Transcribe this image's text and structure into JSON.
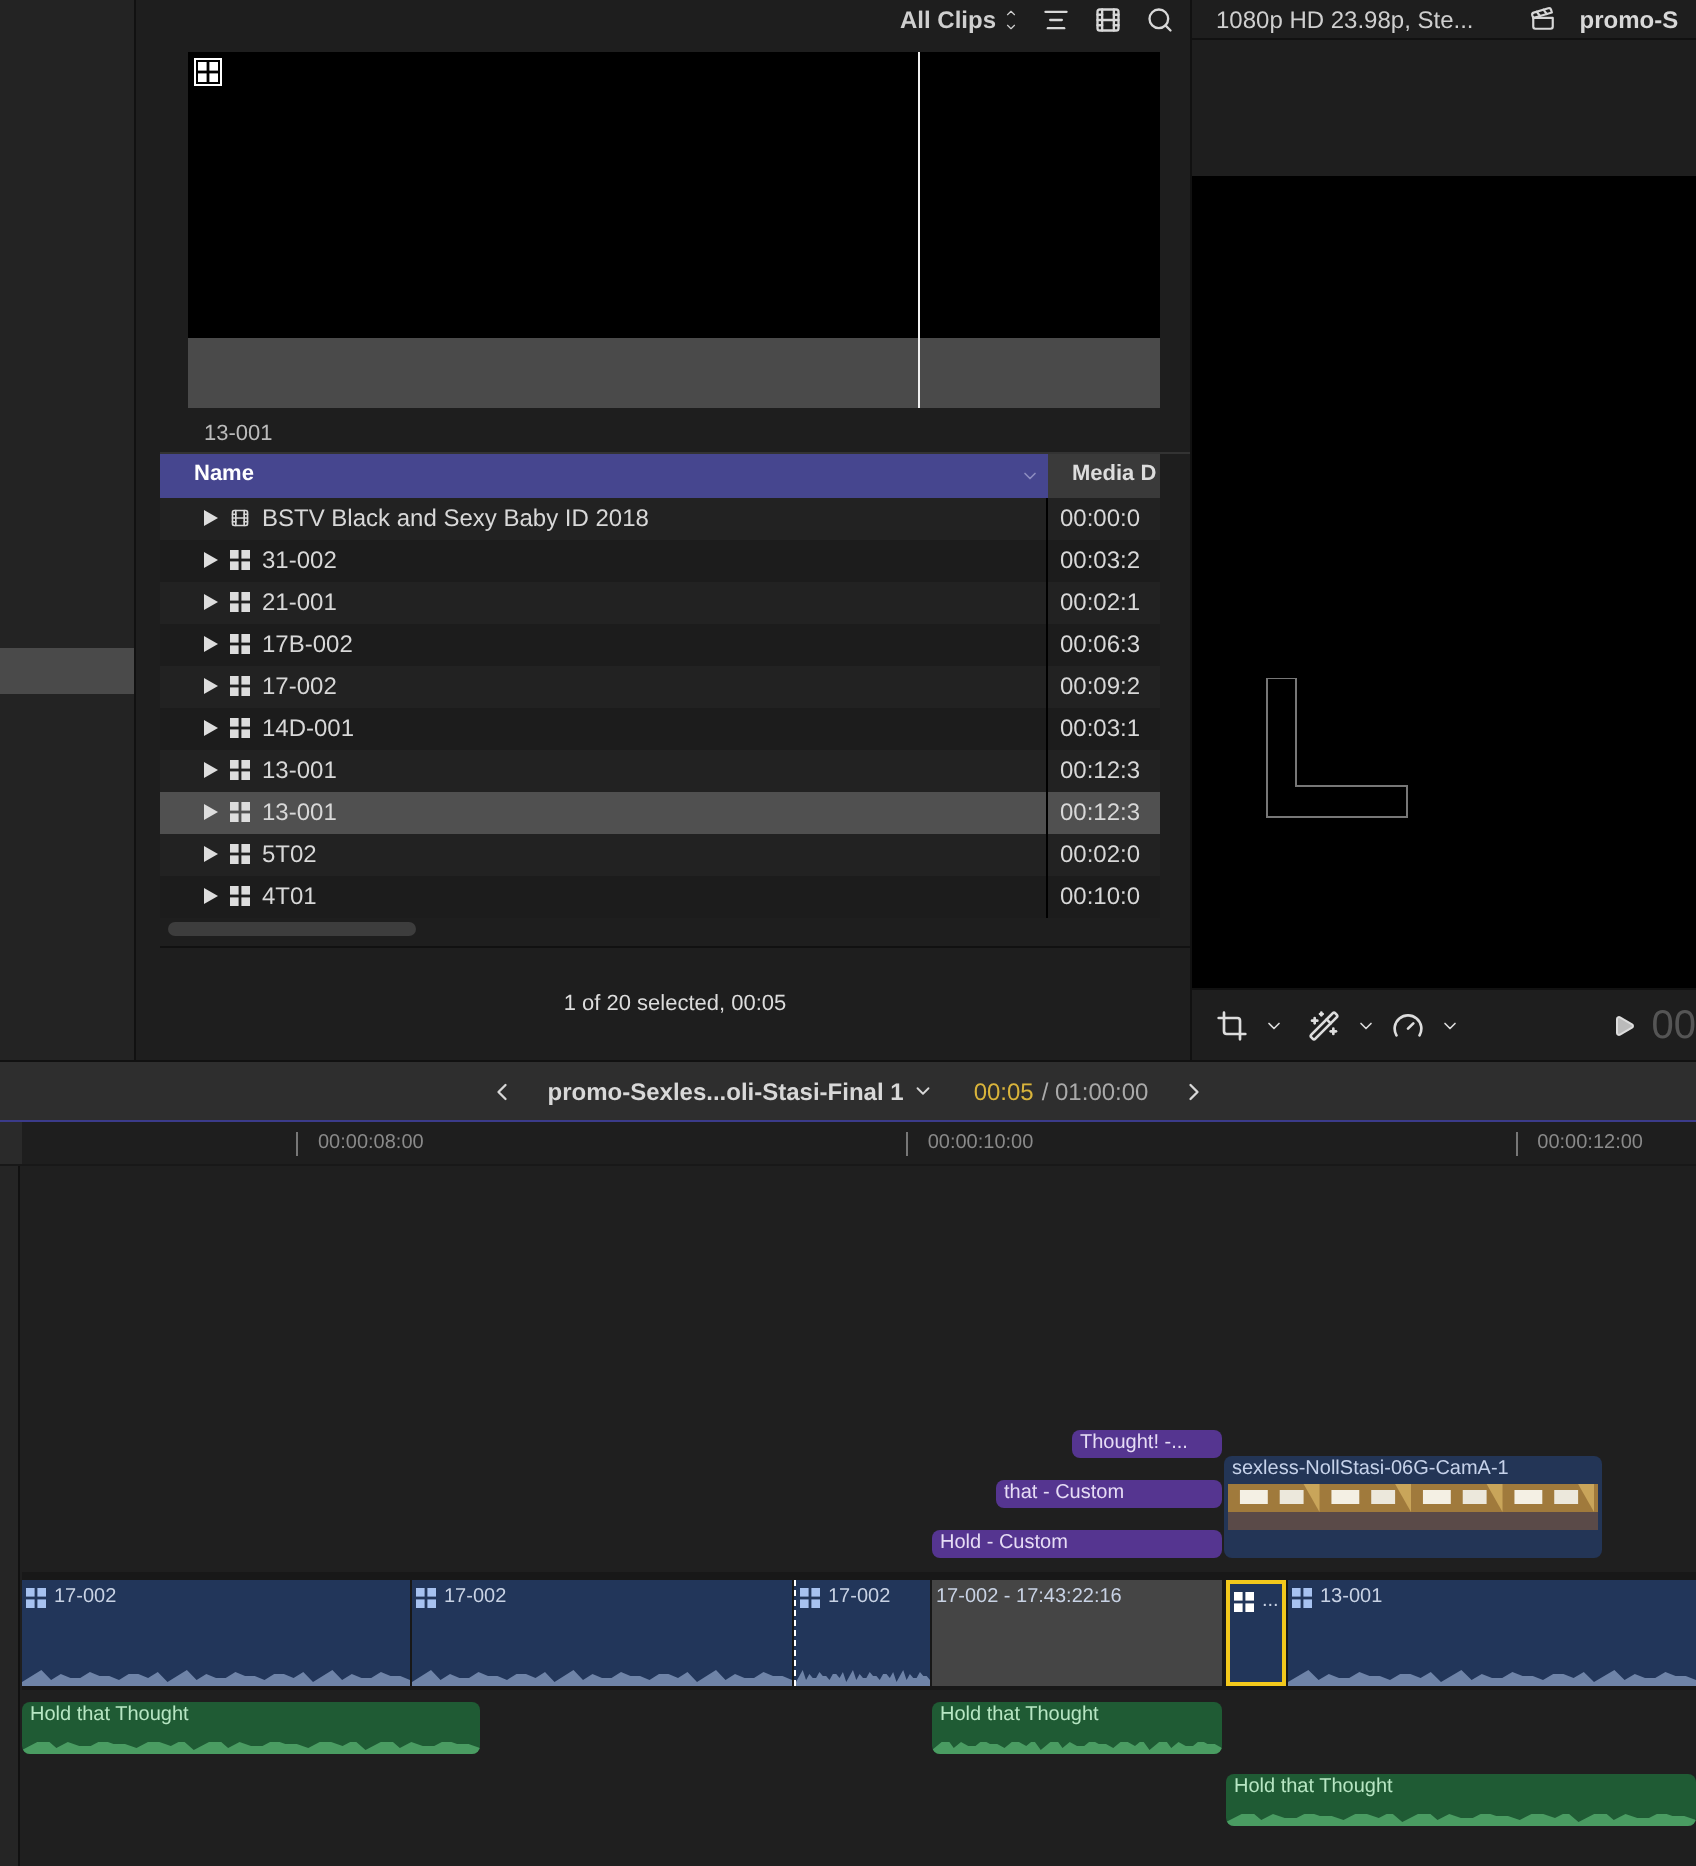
{
  "browser": {
    "filter": "All Clips",
    "filmstrip_label": "13-001",
    "columns": [
      "Name",
      "Media D"
    ],
    "rows": [
      {
        "name": "BSTV Black and Sexy Baby ID 2018",
        "duration": "00:00:0",
        "kind": "clip",
        "selected": false
      },
      {
        "name": "31-002",
        "duration": "00:03:2",
        "kind": "multicam",
        "selected": false
      },
      {
        "name": "21-001",
        "duration": "00:02:1",
        "kind": "multicam",
        "selected": false
      },
      {
        "name": "17B-002",
        "duration": "00:06:3",
        "kind": "multicam",
        "selected": false
      },
      {
        "name": "17-002",
        "duration": "00:09:2",
        "kind": "multicam",
        "selected": false
      },
      {
        "name": "14D-001",
        "duration": "00:03:1",
        "kind": "multicam",
        "selected": false
      },
      {
        "name": "13-001",
        "duration": "00:12:3",
        "kind": "multicam",
        "selected": false
      },
      {
        "name": "13-001",
        "duration": "00:12:3",
        "kind": "multicam",
        "selected": true
      },
      {
        "name": "5T02",
        "duration": "00:02:0",
        "kind": "multicam",
        "selected": false
      },
      {
        "name": "4T01",
        "duration": "00:10:0",
        "kind": "multicam",
        "selected": false
      }
    ],
    "status": "1 of 20 selected, 00:05"
  },
  "sidebar": {
    "highlight": true
  },
  "viewer": {
    "format": "1080p HD 23.98p, Ste...",
    "project": "promo-S",
    "timecode": "00"
  },
  "timeline": {
    "project": "promo-Sexles...oli-Stasi-Final 1",
    "position": "00:05",
    "duration": "/ 01:00:00",
    "ruler": [
      "00:00:08:00",
      "00:00:10:00",
      "00:00:12:00"
    ],
    "clips": [
      {
        "kind": "title",
        "label": "Thought! -..."
      },
      {
        "kind": "title",
        "label": "that - Custom"
      },
      {
        "kind": "title",
        "label": "Hold - Custom"
      },
      {
        "kind": "connected",
        "label": "sexless-NollStasi-06G-CamA-1"
      },
      {
        "kind": "video",
        "label": "17-002",
        "selected": false
      },
      {
        "kind": "video",
        "label": "17-002",
        "selected": false
      },
      {
        "kind": "video",
        "label": "17-002",
        "selected": false
      },
      {
        "kind": "inactive",
        "label": "17-002 - 17:43:22:16",
        "selected": false
      },
      {
        "kind": "video",
        "label": "...",
        "selected": true
      },
      {
        "kind": "video",
        "label": "13-001",
        "selected": false
      },
      {
        "kind": "audio",
        "label": "Hold that Thought"
      },
      {
        "kind": "audio",
        "label": "Hold that Thought"
      },
      {
        "kind": "audio",
        "label": "Hold that Thought"
      }
    ]
  }
}
